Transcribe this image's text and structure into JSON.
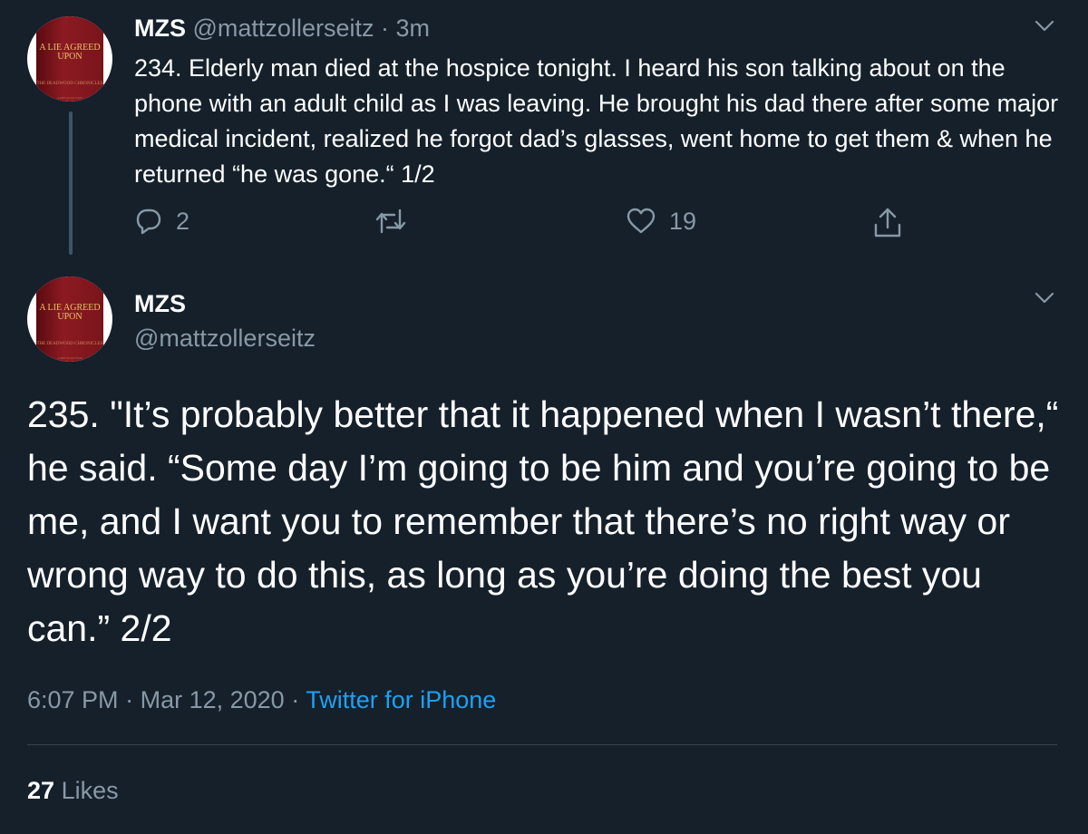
{
  "tweet1": {
    "name": "MZS",
    "handle": "@mattzollerseitz",
    "separator": "·",
    "time": "3m",
    "text": "234. Elderly man died at the hospice tonight. I heard his son talking about on the phone with an adult child as I was leaving. He brought his dad there after some major medical incident, realized he forgot dad’s glasses, went home to get them & when he returned “he was gone.“ 1/2",
    "replies": "2",
    "likes": "19"
  },
  "tweet2": {
    "name": "MZS",
    "handle": "@mattzollerseitz",
    "text": "235. \"It’s probably better that it happened when I wasn’t there,“ he said. “Some day I’m going to be him and you’re going to be me, and I want you to remember that there’s no right way or wrong way to do this, as long as you’re doing the best you can.” 2/2",
    "time": "6:07 PM",
    "sep1": "·",
    "date": "Mar 12, 2020",
    "sep2": "·",
    "source": "Twitter for iPhone",
    "likes_count": "27",
    "likes_label": "Likes"
  },
  "avatar": {
    "title": "A LIE AGREED UPON",
    "subtitle": "THE DEADWOOD CHRONICLES",
    "footer": "A DIRT ROAD TOUR"
  },
  "colors": {
    "background": "#15202b",
    "muted": "#8899a6",
    "link": "#1da1f2",
    "divider": "#38444d"
  },
  "icons": [
    "chevron-down-icon",
    "reply-icon",
    "retweet-icon",
    "like-icon",
    "share-icon"
  ]
}
